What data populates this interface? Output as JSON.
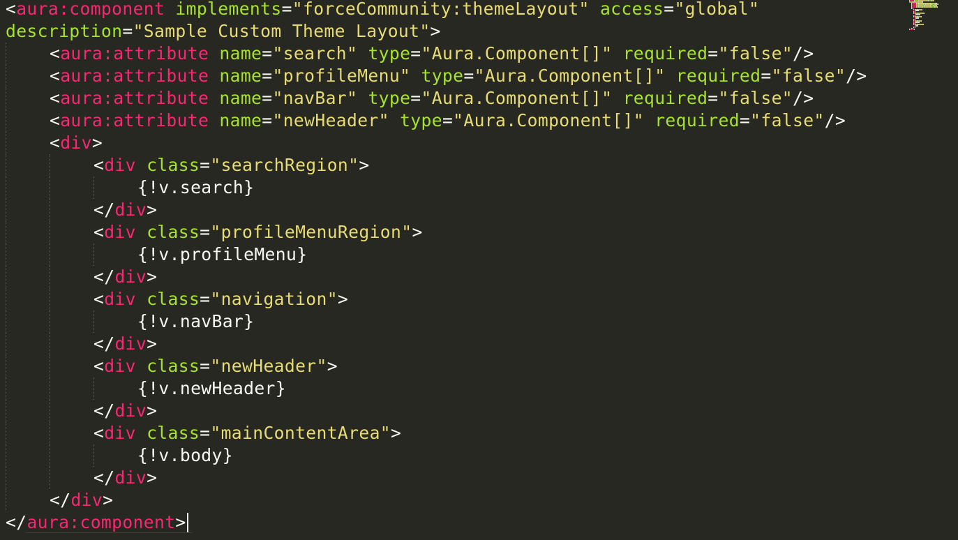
{
  "editor": {
    "theme_colors": {
      "background": "#272822",
      "tag": "#f92672",
      "attribute": "#a6e22e",
      "string": "#e6db74",
      "text": "#f8f8f2"
    },
    "lines": [
      {
        "indent": 0,
        "tokens": [
          [
            "pun",
            "<"
          ],
          [
            "tag",
            "aura:component"
          ],
          [
            "pun",
            " "
          ],
          [
            "attr",
            "implements"
          ],
          [
            "pun",
            "="
          ],
          [
            "str",
            "\"forceCommunity:themeLayout\""
          ],
          [
            "pun",
            " "
          ],
          [
            "attr",
            "access"
          ],
          [
            "pun",
            "="
          ],
          [
            "str",
            "\"global\""
          ]
        ]
      },
      {
        "indent": 0,
        "tokens": [
          [
            "attr",
            "description"
          ],
          [
            "pun",
            "="
          ],
          [
            "str",
            "\"Sample Custom Theme Layout\""
          ],
          [
            "pun",
            ">"
          ]
        ]
      },
      {
        "indent": 1,
        "tokens": [
          [
            "pun",
            "<"
          ],
          [
            "tag",
            "aura:attribute"
          ],
          [
            "pun",
            " "
          ],
          [
            "attr",
            "name"
          ],
          [
            "pun",
            "="
          ],
          [
            "str",
            "\"search\""
          ],
          [
            "pun",
            " "
          ],
          [
            "attr",
            "type"
          ],
          [
            "pun",
            "="
          ],
          [
            "str",
            "\"Aura.Component[]\""
          ],
          [
            "pun",
            " "
          ],
          [
            "attr",
            "required"
          ],
          [
            "pun",
            "="
          ],
          [
            "str",
            "\"false\""
          ],
          [
            "pun",
            "/>"
          ]
        ]
      },
      {
        "indent": 1,
        "tokens": [
          [
            "pun",
            "<"
          ],
          [
            "tag",
            "aura:attribute"
          ],
          [
            "pun",
            " "
          ],
          [
            "attr",
            "name"
          ],
          [
            "pun",
            "="
          ],
          [
            "str",
            "\"profileMenu\""
          ],
          [
            "pun",
            " "
          ],
          [
            "attr",
            "type"
          ],
          [
            "pun",
            "="
          ],
          [
            "str",
            "\"Aura.Component[]\""
          ],
          [
            "pun",
            " "
          ],
          [
            "attr",
            "required"
          ],
          [
            "pun",
            "="
          ],
          [
            "str",
            "\"false\""
          ],
          [
            "pun",
            "/>"
          ]
        ]
      },
      {
        "indent": 1,
        "tokens": [
          [
            "pun",
            "<"
          ],
          [
            "tag",
            "aura:attribute"
          ],
          [
            "pun",
            " "
          ],
          [
            "attr",
            "name"
          ],
          [
            "pun",
            "="
          ],
          [
            "str",
            "\"navBar\""
          ],
          [
            "pun",
            " "
          ],
          [
            "attr",
            "type"
          ],
          [
            "pun",
            "="
          ],
          [
            "str",
            "\"Aura.Component[]\""
          ],
          [
            "pun",
            " "
          ],
          [
            "attr",
            "required"
          ],
          [
            "pun",
            "="
          ],
          [
            "str",
            "\"false\""
          ],
          [
            "pun",
            "/>"
          ]
        ]
      },
      {
        "indent": 1,
        "tokens": [
          [
            "pun",
            "<"
          ],
          [
            "tag",
            "aura:attribute"
          ],
          [
            "pun",
            " "
          ],
          [
            "attr",
            "name"
          ],
          [
            "pun",
            "="
          ],
          [
            "str",
            "\"newHeader\""
          ],
          [
            "pun",
            " "
          ],
          [
            "attr",
            "type"
          ],
          [
            "pun",
            "="
          ],
          [
            "str",
            "\"Aura.Component[]\""
          ],
          [
            "pun",
            " "
          ],
          [
            "attr",
            "required"
          ],
          [
            "pun",
            "="
          ],
          [
            "str",
            "\"false\""
          ],
          [
            "pun",
            "/>"
          ]
        ]
      },
      {
        "indent": 1,
        "tokens": [
          [
            "pun",
            "<"
          ],
          [
            "tag",
            "div"
          ],
          [
            "pun",
            ">"
          ]
        ]
      },
      {
        "indent": 2,
        "tokens": [
          [
            "pun",
            "<"
          ],
          [
            "tag",
            "div"
          ],
          [
            "pun",
            " "
          ],
          [
            "attr",
            "class"
          ],
          [
            "pun",
            "="
          ],
          [
            "str",
            "\"searchRegion\""
          ],
          [
            "pun",
            ">"
          ]
        ]
      },
      {
        "indent": 3,
        "tokens": [
          [
            "txt",
            "{!v.search}"
          ]
        ]
      },
      {
        "indent": 2,
        "tokens": [
          [
            "pun",
            "</"
          ],
          [
            "tag",
            "div"
          ],
          [
            "pun",
            ">"
          ]
        ]
      },
      {
        "indent": 2,
        "tokens": [
          [
            "pun",
            "<"
          ],
          [
            "tag",
            "div"
          ],
          [
            "pun",
            " "
          ],
          [
            "attr",
            "class"
          ],
          [
            "pun",
            "="
          ],
          [
            "str",
            "\"profileMenuRegion\""
          ],
          [
            "pun",
            ">"
          ]
        ]
      },
      {
        "indent": 3,
        "tokens": [
          [
            "txt",
            "{!v.profileMenu}"
          ]
        ]
      },
      {
        "indent": 2,
        "tokens": [
          [
            "pun",
            "</"
          ],
          [
            "tag",
            "div"
          ],
          [
            "pun",
            ">"
          ]
        ]
      },
      {
        "indent": 2,
        "tokens": [
          [
            "pun",
            "<"
          ],
          [
            "tag",
            "div"
          ],
          [
            "pun",
            " "
          ],
          [
            "attr",
            "class"
          ],
          [
            "pun",
            "="
          ],
          [
            "str",
            "\"navigation\""
          ],
          [
            "pun",
            ">"
          ]
        ]
      },
      {
        "indent": 3,
        "tokens": [
          [
            "txt",
            "{!v.navBar}"
          ]
        ]
      },
      {
        "indent": 2,
        "tokens": [
          [
            "pun",
            "</"
          ],
          [
            "tag",
            "div"
          ],
          [
            "pun",
            ">"
          ]
        ]
      },
      {
        "indent": 2,
        "tokens": [
          [
            "pun",
            "<"
          ],
          [
            "tag",
            "div"
          ],
          [
            "pun",
            " "
          ],
          [
            "attr",
            "class"
          ],
          [
            "pun",
            "="
          ],
          [
            "str",
            "\"newHeader\""
          ],
          [
            "pun",
            ">"
          ]
        ]
      },
      {
        "indent": 3,
        "tokens": [
          [
            "txt",
            "{!v.newHeader}"
          ]
        ]
      },
      {
        "indent": 2,
        "tokens": [
          [
            "pun",
            "</"
          ],
          [
            "tag",
            "div"
          ],
          [
            "pun",
            ">"
          ]
        ]
      },
      {
        "indent": 2,
        "tokens": [
          [
            "pun",
            "<"
          ],
          [
            "tag",
            "div"
          ],
          [
            "pun",
            " "
          ],
          [
            "attr",
            "class"
          ],
          [
            "pun",
            "="
          ],
          [
            "str",
            "\"mainContentArea\""
          ],
          [
            "pun",
            ">"
          ]
        ]
      },
      {
        "indent": 3,
        "tokens": [
          [
            "txt",
            "{!v.body}"
          ]
        ]
      },
      {
        "indent": 2,
        "tokens": [
          [
            "pun",
            "</"
          ],
          [
            "tag",
            "div"
          ],
          [
            "pun",
            ">"
          ]
        ]
      },
      {
        "indent": 1,
        "tokens": [
          [
            "pun",
            "</"
          ],
          [
            "tag",
            "div"
          ],
          [
            "pun",
            ">"
          ]
        ]
      },
      {
        "indent": 0,
        "cursor": true,
        "tokens": [
          [
            "pun",
            "</"
          ],
          [
            "tag",
            "aura:component"
          ],
          [
            "pun",
            ">"
          ]
        ]
      }
    ]
  }
}
